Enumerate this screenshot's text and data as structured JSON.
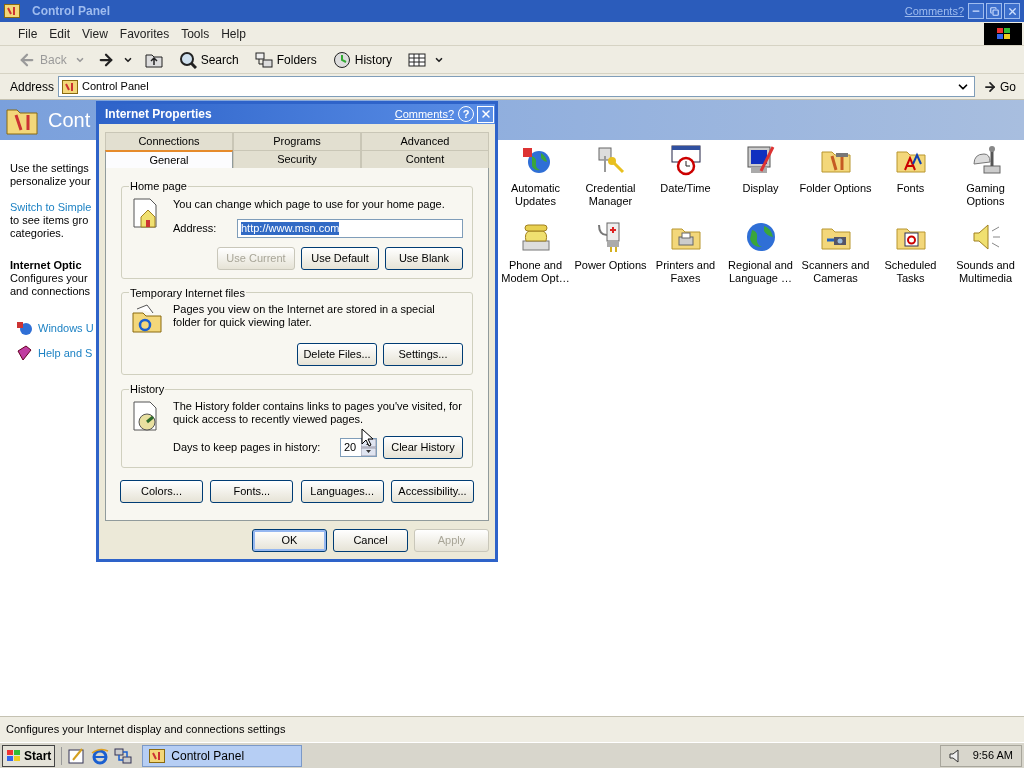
{
  "window": {
    "title": "Control Panel",
    "comments_link": "Comments?"
  },
  "menu": [
    "File",
    "Edit",
    "View",
    "Favorites",
    "Tools",
    "Help"
  ],
  "toolbar": [
    {
      "kind": "back",
      "label": "Back",
      "disabled": true
    },
    {
      "kind": "forward",
      "disabled": false
    },
    {
      "kind": "up",
      "disabled": false
    },
    {
      "kind": "search",
      "label": "Search",
      "disabled": false
    },
    {
      "kind": "folders",
      "label": "Folders",
      "disabled": false
    },
    {
      "kind": "history",
      "label": "History",
      "disabled": false
    },
    {
      "kind": "views",
      "disabled": false
    }
  ],
  "address_bar": {
    "label": "Address",
    "value": "Control Panel",
    "go": "Go"
  },
  "sidebar": {
    "title": "Cont",
    "intro": [
      "Use the settings",
      "personalize your"
    ],
    "switch_link": "Switch to Simple",
    "switch_lines": [
      "to see items gro",
      "categories."
    ],
    "details_title": "Internet Optic",
    "details_lines": [
      "Configures your",
      "and connections"
    ],
    "links": [
      "Windows U",
      "Help and S"
    ]
  },
  "items": [
    {
      "label": "Automatic Updates"
    },
    {
      "label": "Credential Manager"
    },
    {
      "label": "Date/Time"
    },
    {
      "label": "Display"
    },
    {
      "label": "Folder Options"
    },
    {
      "label": "Fonts"
    },
    {
      "label": "Gaming Options"
    },
    {
      "label": "Phone and Modem Opt…"
    },
    {
      "label": "Power Options"
    },
    {
      "label": "Printers and Faxes"
    },
    {
      "label": "Regional and Language …"
    },
    {
      "label": "Scanners and Cameras"
    },
    {
      "label": "Scheduled Tasks"
    },
    {
      "label": "Sounds and Multimedia"
    }
  ],
  "dialog": {
    "title": "Internet Properties",
    "comments_link": "Comments?",
    "help": "?",
    "tab_rows": [
      [
        {
          "label": "Connections",
          "selected": false
        },
        {
          "label": "Programs",
          "selected": false
        },
        {
          "label": "Advanced",
          "selected": false
        }
      ],
      [
        {
          "label": "General",
          "selected": true
        },
        {
          "label": "Security",
          "selected": false
        },
        {
          "label": "Content",
          "selected": false
        }
      ]
    ],
    "home_page": {
      "legend": "Home page",
      "text": "You can change which page to use for your home page.",
      "address_label": "Address:",
      "address": "http://www.msn.com",
      "address_selected": true,
      "buttons": [
        {
          "label": "Use Current",
          "disabled": true
        },
        {
          "label": "Use Default",
          "disabled": false
        },
        {
          "label": "Use Blank",
          "disabled": false
        }
      ]
    },
    "temp_files": {
      "legend": "Temporary Internet files",
      "text": "Pages you view on the Internet are stored in a special folder for quick viewing later.",
      "buttons": [
        {
          "label": "Delete Files...",
          "disabled": false
        },
        {
          "label": "Settings...",
          "disabled": false
        }
      ]
    },
    "history": {
      "legend": "History",
      "text": "The History folder contains links to pages you've visited, for quick access to recently viewed pages.",
      "days_label": "Days to keep pages in history:",
      "days": "20",
      "buttons": [
        {
          "label": "Clear History",
          "disabled": false
        }
      ]
    },
    "bottom_buttons": [
      {
        "label": "Colors...",
        "disabled": false
      },
      {
        "label": "Fonts...",
        "disabled": false
      },
      {
        "label": "Languages...",
        "disabled": false
      },
      {
        "label": "Accessibility...",
        "disabled": false
      }
    ],
    "footer_buttons": [
      {
        "label": "OK",
        "disabled": false,
        "default": true
      },
      {
        "label": "Cancel",
        "disabled": false,
        "default": false
      },
      {
        "label": "Apply",
        "disabled": true,
        "default": false
      }
    ]
  },
  "status_bar": "Configures your Internet display and connections settings",
  "taskbar": {
    "start": "Start",
    "tasks": [
      {
        "label": "Control Panel",
        "selected": true
      }
    ],
    "clock": "9:56 AM"
  }
}
